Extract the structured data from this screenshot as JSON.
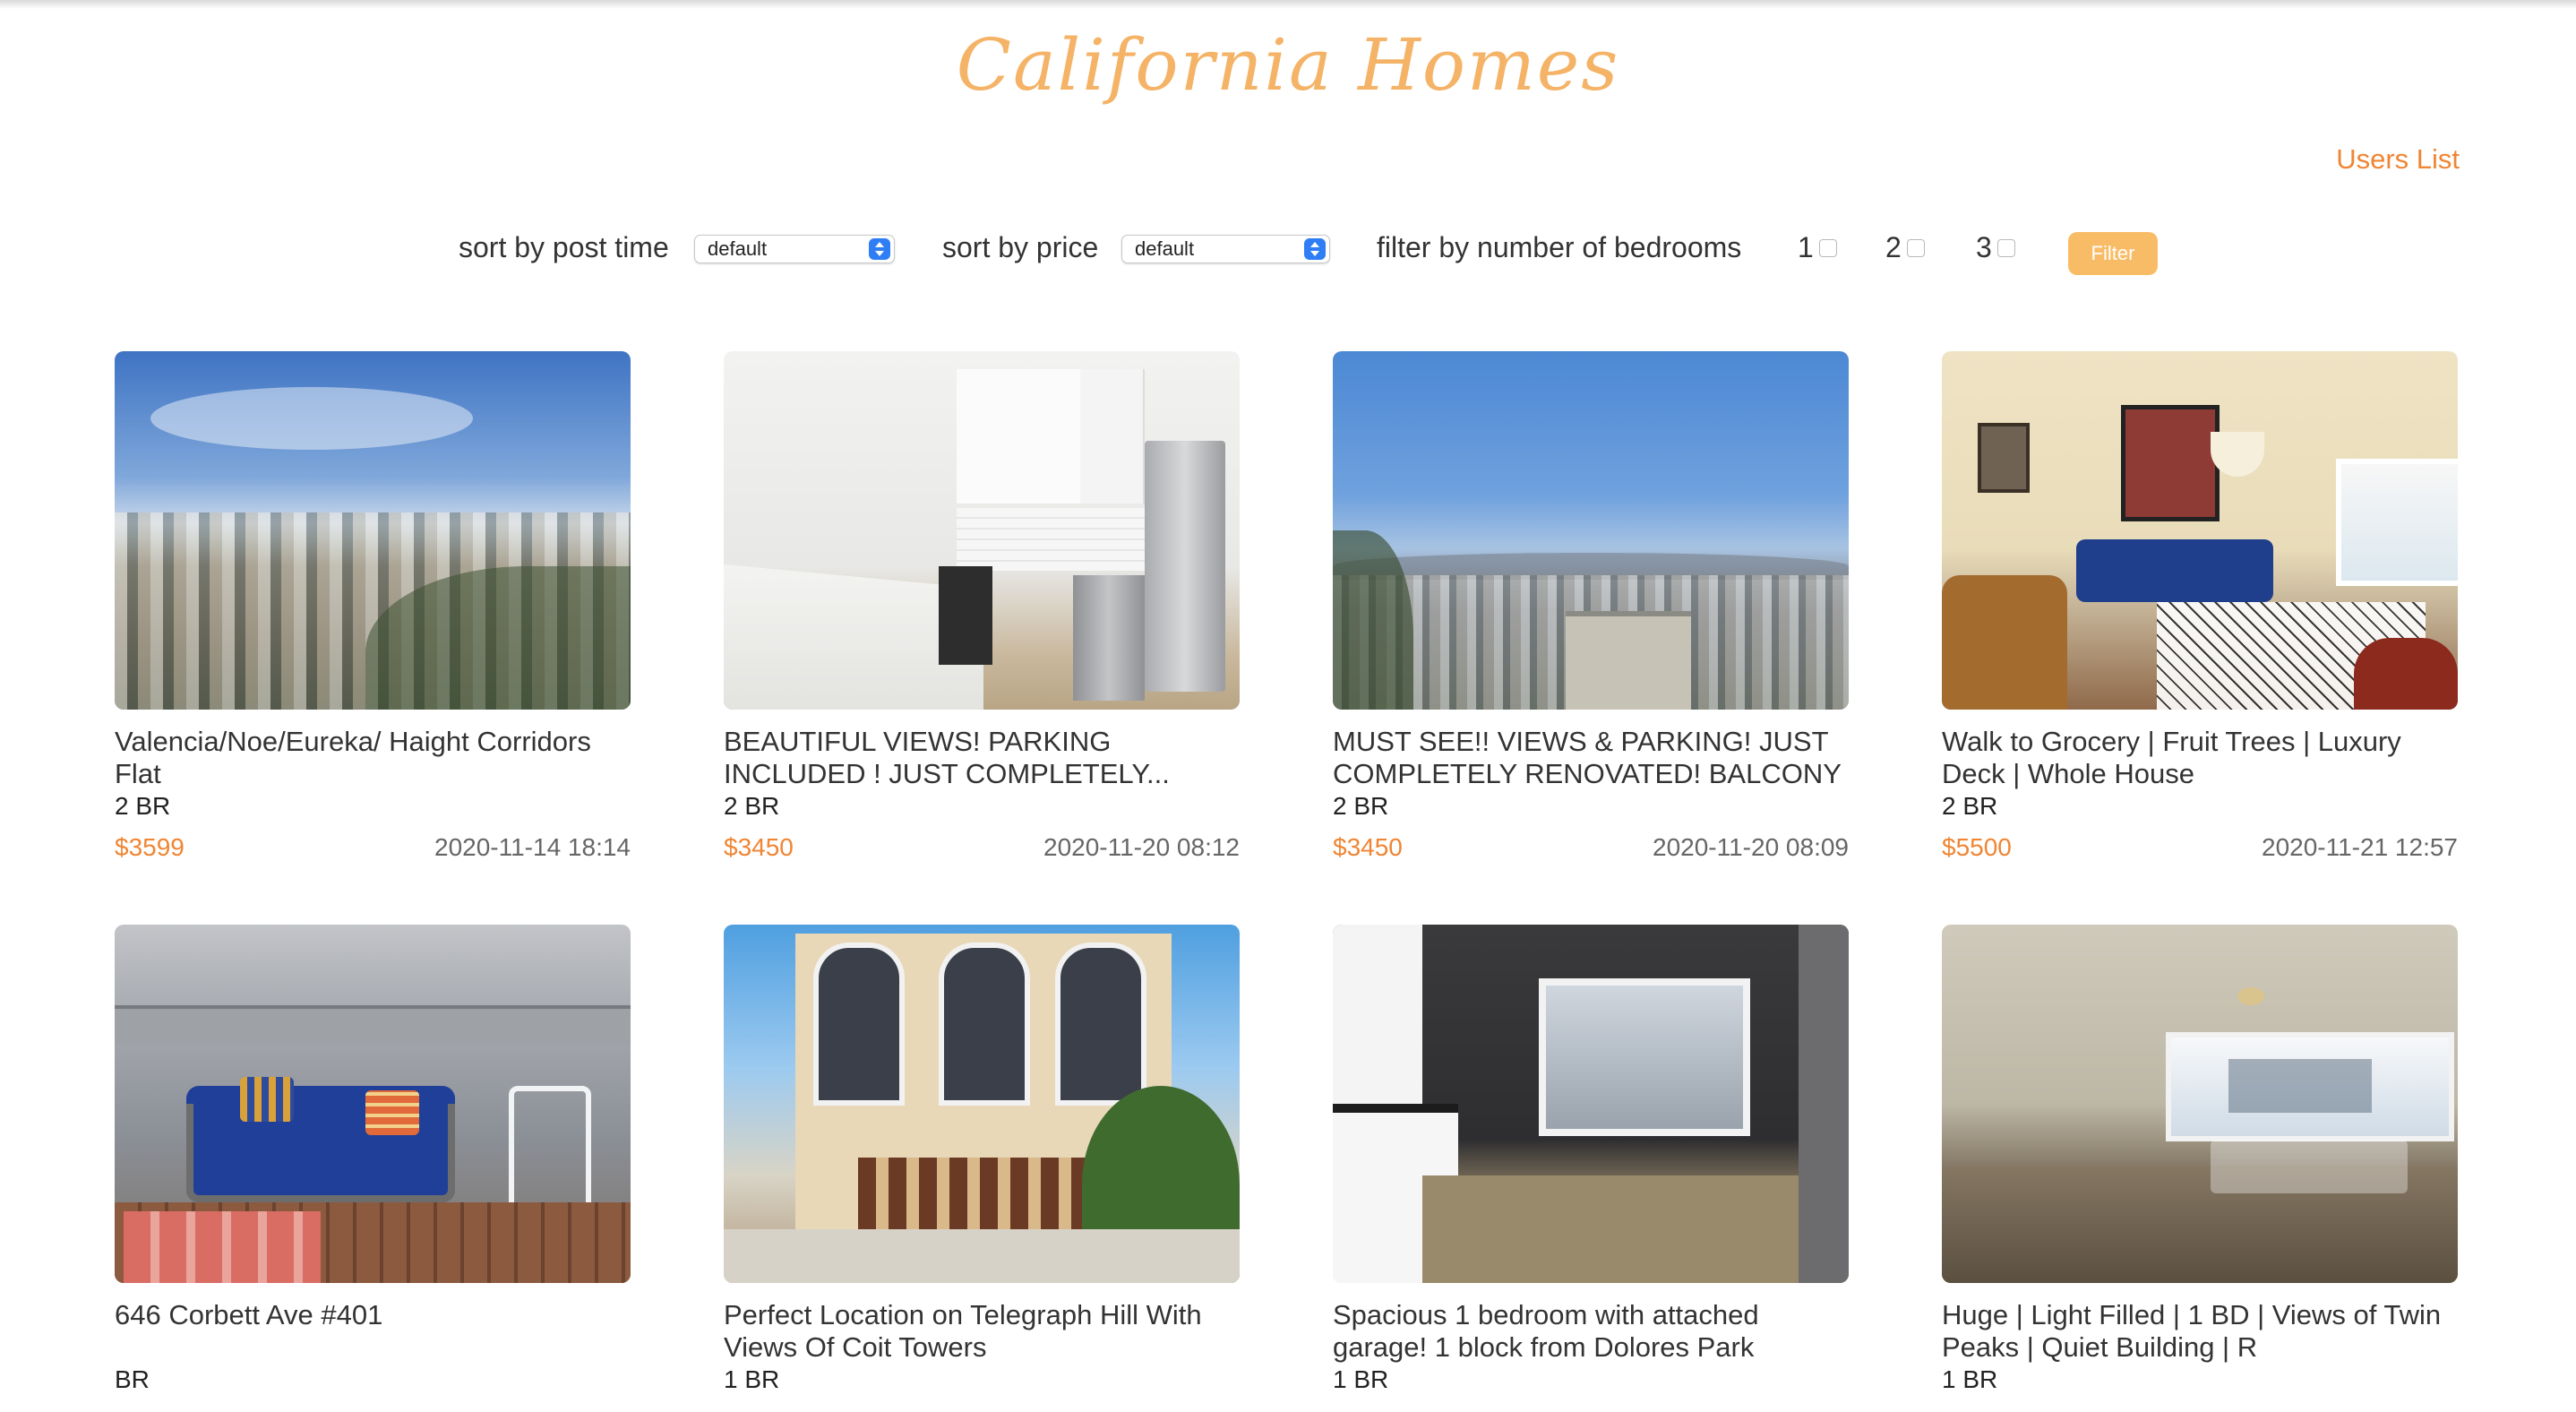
{
  "header": {
    "brand": "California Homes",
    "users_link": "Users List"
  },
  "toolbar": {
    "sort_post_time_label": "sort by post time",
    "sort_post_time_value": "default",
    "sort_price_label": "sort by price",
    "sort_price_value": "default",
    "filter_bedrooms_label": "filter by number of bedrooms",
    "bedroom_options": [
      "1",
      "2",
      "3"
    ],
    "filter_button": "Filter"
  },
  "listings": [
    {
      "title": "Valencia/Noe/Eureka/ Haight Corridors Flat",
      "bedrooms": "2 BR",
      "price": "$3599",
      "posted": "2020-11-14 18:14",
      "photo": "city-hillside-view"
    },
    {
      "title": "BEAUTIFUL VIEWS! PARKING INCLUDED ! JUST COMPLETELY...",
      "bedrooms": "2 BR",
      "price": "$3450",
      "posted": "2020-11-20 08:12",
      "photo": "white-kitchen"
    },
    {
      "title": "MUST SEE!! VIEWS & PARKING! JUST COMPLETELY RENOVATED! BALCONY",
      "bedrooms": "2 BR",
      "price": "$3450",
      "posted": "2020-11-20 08:09",
      "photo": "city-skyline-view"
    },
    {
      "title": "Walk to Grocery | Fruit Trees | Luxury Deck | Whole House",
      "bedrooms": "2 BR",
      "price": "$5500",
      "posted": "2020-11-21 12:57",
      "photo": "living-room"
    },
    {
      "title": "646 Corbett Ave #401",
      "bedrooms": "BR",
      "price": "",
      "posted": "",
      "photo": "rooftop-deck"
    },
    {
      "title": "Perfect Location on Telegraph Hill With Views Of Coit Towers",
      "bedrooms": "1 BR",
      "price": "",
      "posted": "",
      "photo": "building-facade"
    },
    {
      "title": "Spacious 1 bedroom with attached garage! 1 block from Dolores Park",
      "bedrooms": "1 BR",
      "price": "",
      "posted": "",
      "photo": "empty-room-window"
    },
    {
      "title": "Huge | Light Filled | 1 BD | Views of Twin Peaks | Quiet Building | R",
      "bedrooms": "1 BR",
      "price": "",
      "posted": "",
      "photo": "empty-bright-room"
    }
  ],
  "colors": {
    "brand": "#f4b366",
    "accent": "#f08533",
    "filter_button": "#f9bc66",
    "select_stepper": "#2f7ef5"
  }
}
